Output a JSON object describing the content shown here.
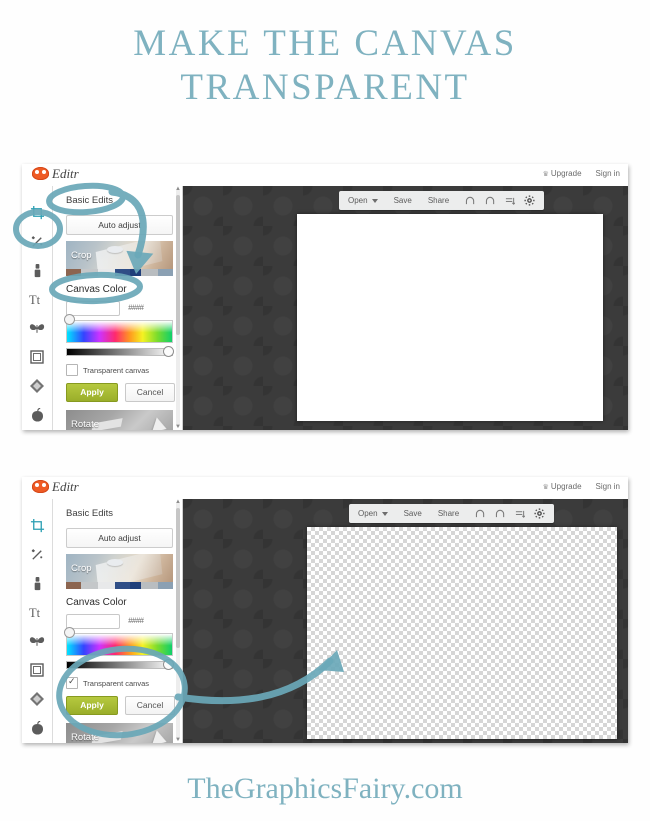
{
  "title": {
    "line1": "MAKE THE CANVAS",
    "line2": "TRANSPARENT",
    "color": "#7fb2c0"
  },
  "footer": {
    "text": "TheGraphicsFairy.com",
    "color": "#7fb2c0"
  },
  "annotation": {
    "color": "#6aa8b8",
    "shapes": "circles-and-arrows"
  },
  "screenshot1": {
    "app": {
      "logo_icon": "monkey-face-icon",
      "logo_text": "Editr",
      "upgrade_icon": "crown-icon",
      "upgrade_label": "Upgrade",
      "signin_label": "Sign in"
    },
    "toolbar": {
      "open_label": "Open",
      "open_caret_icon": "chevron-down-icon",
      "save_label": "Save",
      "share_label": "Share",
      "undo_icon": "undo-icon",
      "redo_icon": "redo-icon",
      "layers_icon": "layers-icon",
      "settings_icon": "gear-icon"
    },
    "tool_rail": [
      {
        "name": "crop-tool",
        "icon": "crop-icon",
        "active": true
      },
      {
        "name": "touch-up-tool",
        "icon": "magic-wand-icon",
        "active": false
      },
      {
        "name": "lipstick-tool",
        "icon": "lipstick-icon",
        "active": false
      },
      {
        "name": "text-tool",
        "icon": "text-tt-icon",
        "active": false
      },
      {
        "name": "overlays-tool",
        "icon": "butterfly-icon",
        "active": false
      },
      {
        "name": "frames-tool",
        "icon": "frame-icon",
        "active": false
      },
      {
        "name": "textures-tool",
        "icon": "texture-diamond-icon",
        "active": false
      },
      {
        "name": "themes-tool",
        "icon": "apple-icon",
        "active": false
      }
    ],
    "panel": {
      "header": "Basic Edits",
      "auto_adjust_label": "Auto adjust",
      "crop_label": "Crop",
      "section_label": "Canvas Color",
      "hex_value": "",
      "hash_icon": "hash-icon",
      "transparent_label": "Transparent canvas",
      "transparent_checked": false,
      "apply_label": "Apply",
      "apply_color": "#a6ba33",
      "cancel_label": "Cancel",
      "rotate_label": "Rotate"
    },
    "canvas": {
      "mode": "white",
      "background": "#ffffff"
    }
  },
  "screenshot2": {
    "app": {
      "logo_icon": "monkey-face-icon",
      "logo_text": "Editr",
      "upgrade_icon": "crown-icon",
      "upgrade_label": "Upgrade",
      "signin_label": "Sign in"
    },
    "toolbar": {
      "open_label": "Open",
      "open_caret_icon": "chevron-down-icon",
      "save_label": "Save",
      "share_label": "Share",
      "undo_icon": "undo-icon",
      "redo_icon": "redo-icon",
      "layers_icon": "layers-icon",
      "settings_icon": "gear-icon"
    },
    "tool_rail": [
      {
        "name": "crop-tool",
        "icon": "crop-icon",
        "active": true
      },
      {
        "name": "touch-up-tool",
        "icon": "magic-wand-icon",
        "active": false
      },
      {
        "name": "lipstick-tool",
        "icon": "lipstick-icon",
        "active": false
      },
      {
        "name": "text-tool",
        "icon": "text-tt-icon",
        "active": false
      },
      {
        "name": "overlays-tool",
        "icon": "butterfly-icon",
        "active": false
      },
      {
        "name": "frames-tool",
        "icon": "frame-icon",
        "active": false
      },
      {
        "name": "textures-tool",
        "icon": "texture-diamond-icon",
        "active": false
      },
      {
        "name": "themes-tool",
        "icon": "apple-icon",
        "active": false
      }
    ],
    "panel": {
      "header": "Basic Edits",
      "auto_adjust_label": "Auto adjust",
      "crop_label": "Crop",
      "section_label": "Canvas Color",
      "hex_value": "",
      "hash_icon": "hash-icon",
      "transparent_label": "Transparent canvas",
      "transparent_checked": true,
      "apply_label": "Apply",
      "apply_color": "#a6ba33",
      "cancel_label": "Cancel",
      "rotate_label": "Rotate"
    },
    "canvas": {
      "mode": "transparent-checkerboard",
      "background": "checkerboard"
    }
  }
}
